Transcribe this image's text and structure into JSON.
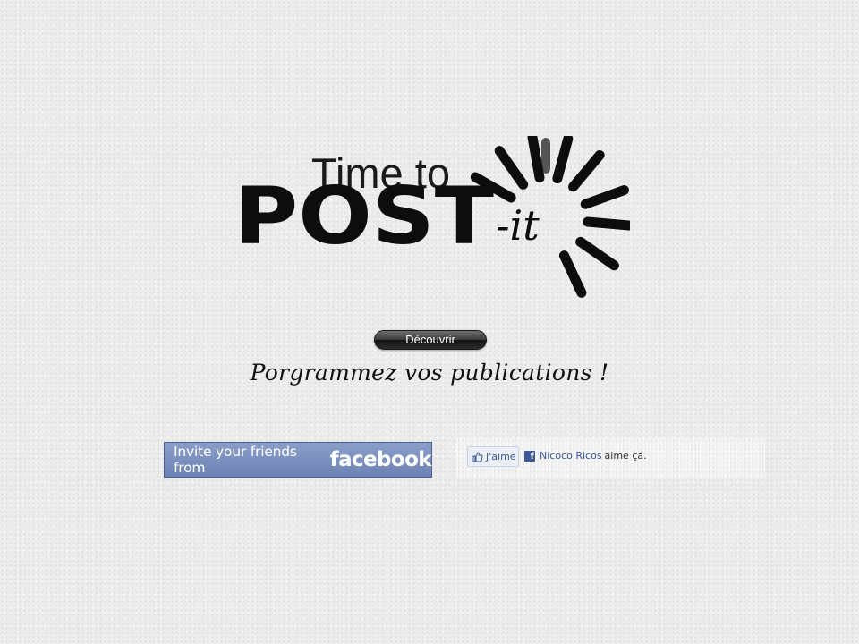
{
  "logo": {
    "line1": "Time to",
    "line2": "POST",
    "line3": "-it"
  },
  "hero": {
    "discover_label": "Découvrir",
    "tagline": "Porgrammez vos publications !"
  },
  "invite": {
    "text": "Invite your friends from",
    "brand": "facebook"
  },
  "like_widget": {
    "button_label": "J'aime",
    "friend_name": "Nicoco Ricos",
    "suffix": "aime ça."
  },
  "colors": {
    "facebook_blue": "#3b5998",
    "invite_bg": "#7a8fbf"
  },
  "icons": {
    "thumb": "thumbs-up-icon",
    "fb": "facebook-f-icon"
  }
}
